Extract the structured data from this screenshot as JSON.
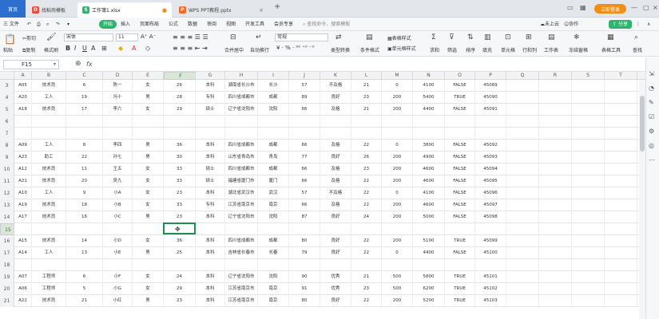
{
  "titlebar": {
    "home": "首页",
    "tabs": [
      {
        "label": "找稻壳模板",
        "icon": "D",
        "color": "#e84c3d"
      },
      {
        "label": "工作簿1.xlsx",
        "icon": "S",
        "color": "#2fb46e"
      },
      {
        "label": "WPS PPT教程.pptx",
        "icon": "P",
        "color": "#f06b2c"
      }
    ],
    "new_tab": "+",
    "login": "立即登录"
  },
  "menubar": {
    "file": "三 文件",
    "start": "开始",
    "items": [
      "插入",
      "页面布局",
      "公式",
      "数据",
      "审阅",
      "视图",
      "开发工具",
      "会员专享"
    ],
    "search": "查找命令、搜索模板",
    "cloud": "未上云",
    "collab": "协作",
    "share": "分享"
  },
  "ribbon": {
    "paste": "粘贴",
    "cut": "剪切",
    "copy": "复制",
    "format_painter": "格式刷",
    "font": "宋体",
    "font_size": "11",
    "merge": "合并居中",
    "wrap": "自动换行",
    "number_format": "常规",
    "type_convert": "类型转换",
    "cond_format": "条件格式",
    "table_style": "表格样式",
    "cell_style": "单元格样式",
    "sum": "求和",
    "filter": "筛选",
    "sort": "排序",
    "fill": "填充",
    "cell": "单元格",
    "row_col": "行和列",
    "worksheet": "工作表",
    "freeze": "冻结窗格",
    "table_tools": "表格工具",
    "find": "查找"
  },
  "formulabar": {
    "namebox": "F15",
    "fx": "fx"
  },
  "columns": [
    "A",
    "B",
    "C",
    "D",
    "E",
    "F",
    "G",
    "H",
    "I",
    "J",
    "K",
    "L",
    "M",
    "N",
    "O",
    "P",
    "Q",
    "R",
    "S",
    "T"
  ],
  "rows": [
    {
      "n": "3",
      "cells": [
        "A05",
        "技术员",
        "6",
        "陈一",
        "女",
        "26",
        "本科",
        "湖南省长沙市",
        "长沙",
        "57",
        "不及格",
        "21",
        "0",
        "4100",
        "FALSE",
        "45089"
      ]
    },
    {
      "n": "4",
      "cells": [
        "A20",
        "工人",
        "19",
        "冯十",
        "男",
        "28",
        "专科",
        "四川省成都市",
        "成都",
        "89",
        "良好",
        "23",
        "200",
        "5400",
        "TRUE",
        "45090"
      ]
    },
    {
      "n": "5",
      "cells": [
        "A18",
        "技术员",
        "17",
        "李六",
        "女",
        "29",
        "硕士",
        "辽宁省沈阳市",
        "沈阳",
        "66",
        "及格",
        "21",
        "200",
        "4400",
        "FALSE",
        "45091"
      ]
    },
    {
      "n": "6",
      "cells": []
    },
    {
      "n": "7",
      "cells": []
    },
    {
      "n": "8",
      "cells": [
        "A09",
        "工人",
        "8",
        "李四",
        "男",
        "36",
        "本科",
        "四川省成都市",
        "成都",
        "66",
        "及格",
        "22",
        "0",
        "3800",
        "FALSE",
        "45092"
      ]
    },
    {
      "n": "9",
      "cells": [
        "A23",
        "助工",
        "22",
        "孙七",
        "男",
        "30",
        "本科",
        "山东省青岛市",
        "青岛",
        "77",
        "良好",
        "26",
        "200",
        "4900",
        "FALSE",
        "45093"
      ]
    },
    {
      "n": "10",
      "cells": [
        "A12",
        "技术员",
        "11",
        "王五",
        "女",
        "33",
        "硕士",
        "四川省成都市",
        "成都",
        "66",
        "及格",
        "23",
        "200",
        "4600",
        "FALSE",
        "45094"
      ]
    },
    {
      "n": "11",
      "cells": [
        "A21",
        "技术员",
        "20",
        "吴九",
        "女",
        "33",
        "硕士",
        "福建省厦门市",
        "厦门",
        "66",
        "及格",
        "22",
        "200",
        "4600",
        "FALSE",
        "45095"
      ]
    },
    {
      "n": "12",
      "cells": [
        "A10",
        "工人",
        "9",
        "小A",
        "女",
        "23",
        "本科",
        "湖北省武汉市",
        "武汉",
        "57",
        "不及格",
        "22",
        "0",
        "4100",
        "FALSE",
        "45096"
      ]
    },
    {
      "n": "13",
      "cells": [
        "A19",
        "技术员",
        "18",
        "小B",
        "女",
        "33",
        "专科",
        "江苏省南京市",
        "南京",
        "66",
        "及格",
        "22",
        "200",
        "4600",
        "FALSE",
        "45097"
      ]
    },
    {
      "n": "14",
      "cells": [
        "A17",
        "技术员",
        "16",
        "小C",
        "男",
        "23",
        "本科",
        "辽宁省沈阳市",
        "沈阳",
        "87",
        "良好",
        "24",
        "200",
        "5000",
        "FALSE",
        "45098"
      ]
    },
    {
      "n": "15",
      "cells": []
    },
    {
      "n": "16",
      "cells": [
        "A15",
        "技术员",
        "14",
        "小D",
        "女",
        "36",
        "本科",
        "四川省成都市",
        "成都",
        "80",
        "良好",
        "22",
        "200",
        "5100",
        "TRUE",
        "45099"
      ]
    },
    {
      "n": "17",
      "cells": [
        "A14",
        "工人",
        "13",
        "小E",
        "男",
        "25",
        "本科",
        "吉林省长春市",
        "长春",
        "79",
        "良好",
        "22",
        "0",
        "4400",
        "FALSE",
        "45100"
      ]
    },
    {
      "n": "18",
      "cells": []
    },
    {
      "n": "19",
      "cells": [
        "A07",
        "工程师",
        "6",
        "小F",
        "女",
        "24",
        "本科",
        "辽宁省沈阳市",
        "沈阳",
        "90",
        "优秀",
        "21",
        "500",
        "5800",
        "TRUE",
        "45101"
      ]
    },
    {
      "n": "20",
      "cells": [
        "A06",
        "工程师",
        "5",
        "小G",
        "女",
        "29",
        "本科",
        "江苏省南京市",
        "南京",
        "91",
        "优秀",
        "23",
        "500",
        "6200",
        "TRUE",
        "45102"
      ]
    },
    {
      "n": "21",
      "cells": [
        "A22",
        "技术员",
        "21",
        "小红",
        "男",
        "23",
        "本科",
        "江苏省南京市",
        "南京",
        "80",
        "良好",
        "22",
        "200",
        "5200",
        "TRUE",
        "45103"
      ]
    }
  ]
}
